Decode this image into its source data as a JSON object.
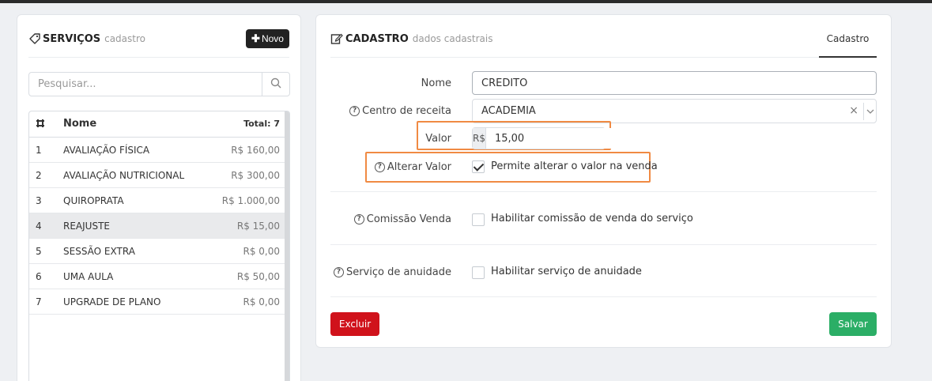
{
  "services_panel": {
    "title": "SERVIÇOS",
    "subtitle": "cadastro",
    "new_button_label": "Novo",
    "search_placeholder": "Pesquisar...",
    "table": {
      "col_name": "Nome",
      "total_label": "Total: 7",
      "rows": [
        {
          "num": "1",
          "name": "AVALIAÇÃO FÍSICA",
          "price": "R$ 160,00"
        },
        {
          "num": "2",
          "name": "AVALIAÇÃO NUTRICIONAL",
          "price": "R$ 300,00"
        },
        {
          "num": "3",
          "name": "QUIROPRATA",
          "price": "R$ 1.000,00"
        },
        {
          "num": "4",
          "name": "REAJUSTE",
          "price": "R$ 15,00"
        },
        {
          "num": "5",
          "name": "SESSÃO EXTRA",
          "price": "R$ 0,00"
        },
        {
          "num": "6",
          "name": "UMA AULA",
          "price": "R$ 50,00"
        },
        {
          "num": "7",
          "name": "UPGRADE DE PLANO",
          "price": "R$ 0,00"
        }
      ]
    }
  },
  "form_panel": {
    "title": "CADASTRO",
    "subtitle": "dados cadastrais",
    "tab_label": "Cadastro",
    "nome": {
      "label": "Nome",
      "value": "CREDITO"
    },
    "centro_receita": {
      "label": "Centro de receita",
      "value": "ACADEMIA",
      "clear": "×"
    },
    "valor": {
      "label": "Valor",
      "prefix": "R$",
      "value": "15,00"
    },
    "alterar_valor": {
      "label": "Alterar Valor",
      "checkbox_label": "Permite alterar o valor na venda"
    },
    "comissao": {
      "label": "Comissão Venda",
      "checkbox_label": "Habilitar comissão de venda do serviço"
    },
    "anuidade": {
      "label": "Serviço de anuidade",
      "checkbox_label": "Habilitar serviço de anuidade"
    },
    "help_glyph": "?",
    "delete_label": "Excluir",
    "save_label": "Salvar"
  },
  "colors": {
    "highlight": "#f08a43",
    "delete": "#d0121b",
    "save": "#2bae66"
  }
}
